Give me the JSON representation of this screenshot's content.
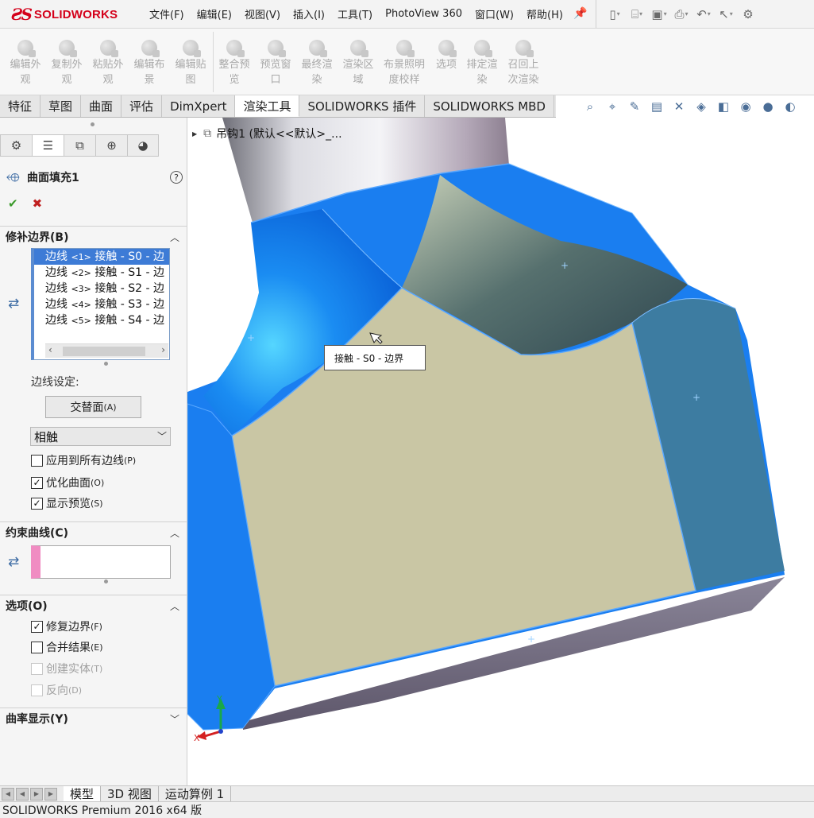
{
  "app": {
    "logo_text": "SOLIDWORKS",
    "status_text": "SOLIDWORKS Premium 2016 x64 版"
  },
  "menus": [
    "文件(F)",
    "编辑(E)",
    "视图(V)",
    "插入(I)",
    "工具(T)",
    "PhotoView 360",
    "窗口(W)",
    "帮助(H)"
  ],
  "commands": [
    {
      "line1": "编辑外",
      "line2": "观"
    },
    {
      "line1": "复制外",
      "line2": "观"
    },
    {
      "line1": "粘贴外",
      "line2": "观"
    },
    {
      "line1": "编辑布",
      "line2": "景"
    },
    {
      "line1": "编辑贴",
      "line2": "图"
    },
    {
      "line1": "整合预",
      "line2": "览"
    },
    {
      "line1": "预览窗",
      "line2": "口"
    },
    {
      "line1": "最终渲",
      "line2": "染"
    },
    {
      "line1": "渲染区",
      "line2": "域"
    },
    {
      "line1": "布景照明",
      "line2": "度校样"
    },
    {
      "line1": "选项",
      "line2": ""
    },
    {
      "line1": "排定渲",
      "line2": "染"
    },
    {
      "line1": "召回上",
      "line2": "次渲染"
    }
  ],
  "tabs": [
    "特征",
    "草图",
    "曲面",
    "评估",
    "DimXpert",
    "渲染工具",
    "SOLIDWORKS 插件",
    "SOLIDWORKS MBD"
  ],
  "active_tab_index": 5,
  "feature": {
    "title": "曲面填充1"
  },
  "sections": {
    "patch_boundary": "修补边界(B)",
    "constraint_curves": "约束曲线(C)",
    "options": "选项(O)",
    "curvature_display": "曲率显示(Y)"
  },
  "edges": [
    {
      "prefix": "边线",
      "num": "<1>",
      "rest": "接触 - S0 - 边"
    },
    {
      "prefix": "边线",
      "num": "<2>",
      "rest": "接触 - S1 - 边"
    },
    {
      "prefix": "边线",
      "num": "<3>",
      "rest": "接触 - S2 - 边"
    },
    {
      "prefix": "边线",
      "num": "<4>",
      "rest": "接触 - S3 - 边"
    },
    {
      "prefix": "边线",
      "num": "<5>",
      "rest": "接触 - S4 - 边"
    }
  ],
  "edge_settings_label": "边线设定:",
  "intersect_button": {
    "label": "交替面",
    "key": "(A)"
  },
  "contact_select": {
    "value": "相触"
  },
  "checks": {
    "apply_all": {
      "label": "应用到所有边线",
      "key": "(P)",
      "checked": false
    },
    "optimize": {
      "label": "优化曲面",
      "key": "(O)",
      "checked": true
    },
    "show_preview": {
      "label": "显示预览",
      "key": "(S)",
      "checked": true
    },
    "fix_boundary": {
      "label": "修复边界",
      "key": "(F)",
      "checked": true
    },
    "merge_result": {
      "label": "合并结果",
      "key": "(E)",
      "checked": false
    },
    "create_solid": {
      "label": "创建实体",
      "key": "(T)",
      "checked": false
    },
    "reverse": {
      "label": "反向",
      "key": "(D)",
      "checked": false
    }
  },
  "tree": {
    "label": "吊钩1 (默认<<默认>_..."
  },
  "tooltip": "接触 - S0 - 边界",
  "bottom_tabs": [
    "模型",
    "3D 视图",
    "运动算例 1"
  ],
  "triad": {
    "x": "X",
    "y": "Y"
  },
  "colors": {
    "brand_red": "#d4001a",
    "surface_blue": "#1a7ef0",
    "fill_surface": "#c9c6a4",
    "selection_blue": "#3d7bd6",
    "constraint_pink": "#f08cc2"
  }
}
